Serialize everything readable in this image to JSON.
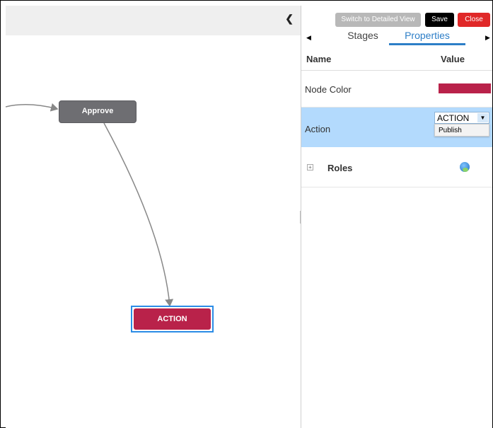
{
  "canvas": {
    "collapse_icon": "chevron-left-icon",
    "nodes": {
      "approve_label": "Approve",
      "action_label": "ACTION"
    }
  },
  "toolbar": {
    "switch_view_label": "Switch to Detailed View",
    "save_label": "Save",
    "close_label": "Close"
  },
  "tabs": [
    {
      "label": "Stages",
      "active": false
    },
    {
      "label": "Properties",
      "active": true
    }
  ],
  "properties": {
    "header_name": "Name",
    "header_value": "Value",
    "node_color": {
      "label": "Node Color",
      "color": "#b9224a"
    },
    "action": {
      "label": "Action",
      "selected": "ACTION",
      "dropdown_option": "Publish"
    },
    "roles": {
      "label": "Roles",
      "icon": "roles-icon"
    }
  },
  "colors": {
    "accent": "#2d7ec7",
    "selected_row": "#b3dafd",
    "approve_node": "#6e6e72",
    "action_node": "#b9224a",
    "close_button": "#e02828"
  }
}
